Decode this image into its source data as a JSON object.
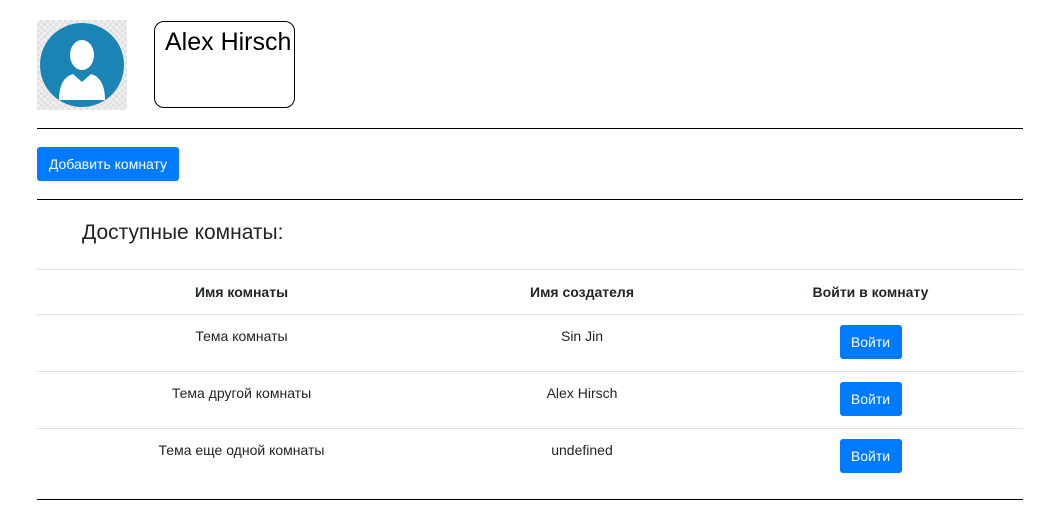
{
  "header": {
    "user_name": "Alex Hirsch"
  },
  "actions": {
    "add_room_label": "Добавить комнату"
  },
  "rooms_section": {
    "title": "Доступные комнаты:",
    "columns": [
      "Имя комнаты",
      "Имя создателя",
      "Войти в комнату"
    ],
    "rows": [
      {
        "room_name": "Тема комнаты",
        "creator": "Sin Jin",
        "enter_label": "Войти"
      },
      {
        "room_name": "Тема другой комнаты",
        "creator": "Alex Hirsch",
        "enter_label": "Войти"
      },
      {
        "room_name": "Тема еще одной комнаты",
        "creator": "undefined",
        "enter_label": "Войти"
      }
    ]
  },
  "colors": {
    "primary": "#007bff",
    "avatar": "#1a84b5"
  }
}
